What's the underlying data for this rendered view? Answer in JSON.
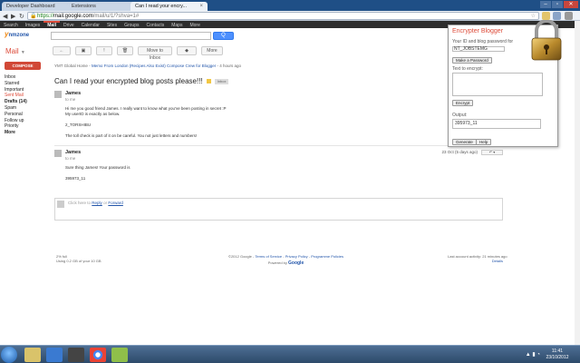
{
  "browser": {
    "tabs": [
      {
        "label": "Developer Dashboard",
        "active": false
      },
      {
        "label": "Extensions",
        "active": false
      },
      {
        "label": "Can I read your encry...",
        "active": true
      }
    ],
    "url_scheme": "https://",
    "url_host": "mail.google.com",
    "url_path": "/mail/u/1/?shva=1#"
  },
  "gbar": {
    "items": [
      "Search",
      "Images",
      "Mail",
      "Drive",
      "Calendar",
      "Sites",
      "Groups",
      "Contacts",
      "Maps",
      "More"
    ]
  },
  "header": {
    "logo_y": "y",
    "logo_zone": "nmzone",
    "search_placeholder": "",
    "search_button_label": "Q"
  },
  "left_nav": {
    "mail_label": "Mail",
    "compose_label": "COMPOSE",
    "items": [
      "Inbox",
      "Starred",
      "Important",
      "Sent Mail",
      "Drafts (14)",
      "Spam",
      "Personal",
      "Follow up",
      "Priority",
      "More"
    ]
  },
  "actions": {
    "back": "←",
    "archive": "▣",
    "report": "!",
    "delete": "🗑",
    "move_to_inbox": "Move to Inbox",
    "labels": "◆",
    "more": "More"
  },
  "thread": {
    "breadcrumb_prefix": "YMT Global Home",
    "breadcrumb_link": "Memo From London (Recipes Also Exist) Compose Crew for Blogger",
    "breadcrumb_suffix": "- 4 hours ago",
    "subject": "Can I read your encrypted blog posts please!!!",
    "label_chip": "Inbox",
    "messages": [
      {
        "sender": "James",
        "to": "to me",
        "date": "23 Oct",
        "lines": [
          "Hi me you good friend James. I really want to know what you've been posting in secret :P",
          "My userID is exactly as below.",
          "",
          "2_TORSHIBU",
          "",
          "The toll check is part of it on be careful. You not just letters and numbers!"
        ]
      },
      {
        "sender": "James",
        "to": "to me",
        "date": "23 Oct (5 days ago)",
        "lines": [
          "Sure thing James! Your password is",
          "",
          "395973_11"
        ]
      }
    ],
    "reply_prompt": "Click here to",
    "reply_link": "Reply",
    "reply_or": "or",
    "forward_link": "Forward"
  },
  "footer": {
    "usage_line1": "2% full",
    "usage_line2": "Using 0.2 GB of your 10 GB",
    "copyright": "©2012 Google -",
    "terms": "Terms of Service",
    "privacy": "Privacy Policy",
    "program": "Programme Policies",
    "powered": "Powered by",
    "google": "Google",
    "activity": "Last account activity: 21 minutes ago",
    "details": "Details"
  },
  "extension": {
    "title": "Encrypter Blogger",
    "id_label": "Your ID and blog password for",
    "id_value": "NT_JOBSTEMG",
    "make_password_button": "Make a Password",
    "text_label": "Text to encrypt:",
    "encrypt_button": "Encrypt",
    "output_label": "Output:",
    "output_value": "395973_11",
    "generate_button": "Generate",
    "help_button": "Help"
  },
  "taskbar": {
    "time": "11:41",
    "date": "23/10/2012"
  }
}
